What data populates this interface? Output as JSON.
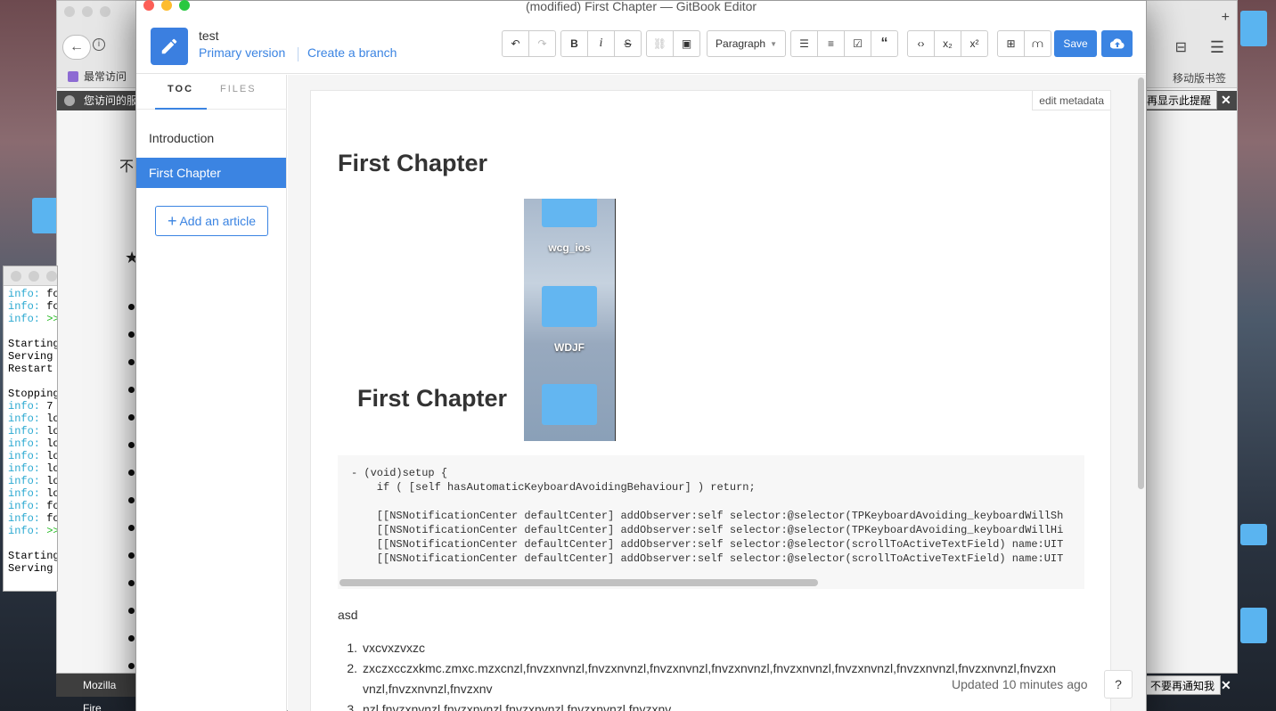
{
  "window_title": "(modified) First Chapter — GitBook Editor",
  "book": {
    "title": "test",
    "primary_version": "Primary version",
    "create_branch": "Create a branch"
  },
  "toolbar": {
    "format_select": "Paragraph",
    "save": "Save",
    "italic": "i",
    "bold": "B",
    "strike": "S"
  },
  "sidebar": {
    "tabs": [
      "TOC",
      "FILES"
    ],
    "items": [
      {
        "label": "Introduction"
      },
      {
        "label": "First Chapter"
      }
    ],
    "add_article": "Add an article"
  },
  "editor": {
    "edit_metadata": "edit metadata",
    "heading": "First Chapter",
    "image_caption": "First Chapter",
    "image_labels": [
      "wcg_ios",
      "WDJF"
    ],
    "code": "- (void)setup {\n    if ( [self hasAutomaticKeyboardAvoidingBehaviour] ) return;\n\n    [[NSNotificationCenter defaultCenter] addObserver:self selector:@selector(TPKeyboardAvoiding_keyboardWillSh\n    [[NSNotificationCenter defaultCenter] addObserver:self selector:@selector(TPKeyboardAvoiding_keyboardWillHi\n    [[NSNotificationCenter defaultCenter] addObserver:self selector:@selector(scrollToActiveTextField) name:UIT\n    [[NSNotificationCenter defaultCenter] addObserver:self selector:@selector(scrollToActiveTextField) name:UIT",
    "paragraph": "asd",
    "list": [
      {
        "num": "1.",
        "text": "vxcvxzvxzc"
      },
      {
        "num": "2.",
        "text": "zxczxcczxkmc.zmxc.mzxcnzl,fnvzxnvnzl,fnvzxnvnzl,fnvzxnvnzl,fnvzxnvnzl,fnvzxnvnzl,fnvzxnvnzl,fnvzxnvnzl,fnvzxnvnzl,fnvzxnvnzl,fnvzxnvnzl,fnvzxnv"
      },
      {
        "num": "3.",
        "text": "nzl,fnvzxnvnzl,fnvzxnvnzl,fnvzxnvnzl,fnvzxnvnzl,fnvzxnv"
      }
    ],
    "updated": "Updated 10 minutes ago",
    "help": "?"
  },
  "background": {
    "browser_bookmark": "最常访问",
    "notice_text": "您访问的服务",
    "notice_right": "再显示此提醒",
    "taskbar_app": "Mozilla Fire",
    "taskbar_notice": "不要再通知我",
    "mobile_bookmarks": "移动版书签",
    "bg_chars": [
      "不"
    ],
    "terminal_lines": [
      {
        "k": "info:",
        "t": " fo"
      },
      {
        "k": "info:",
        "t": " fo"
      },
      {
        "k": "info:",
        "t": " >>",
        "g": true
      },
      {
        "k": "",
        "t": ""
      },
      {
        "k": "",
        "t": "Starting"
      },
      {
        "k": "",
        "t": "Serving "
      },
      {
        "k": "",
        "t": "Restart "
      },
      {
        "k": "",
        "t": ""
      },
      {
        "k": "",
        "t": "Stopping"
      },
      {
        "k": "info:",
        "t": " 7 "
      },
      {
        "k": "info:",
        "t": " lo"
      },
      {
        "k": "info:",
        "t": " lo"
      },
      {
        "k": "info:",
        "t": " lo"
      },
      {
        "k": "info:",
        "t": " lo"
      },
      {
        "k": "info:",
        "t": " lo"
      },
      {
        "k": "info:",
        "t": " lo"
      },
      {
        "k": "info:",
        "t": " lo"
      },
      {
        "k": "info:",
        "t": " fo"
      },
      {
        "k": "info:",
        "t": " fo"
      },
      {
        "k": "info:",
        "t": " >>",
        "g": true
      },
      {
        "k": "",
        "t": ""
      },
      {
        "k": "",
        "t": "Starting"
      },
      {
        "k": "",
        "t": "Serving "
      }
    ]
  },
  "colors": {
    "accent": "#3b84e2",
    "active_item": "#3b84e2"
  }
}
